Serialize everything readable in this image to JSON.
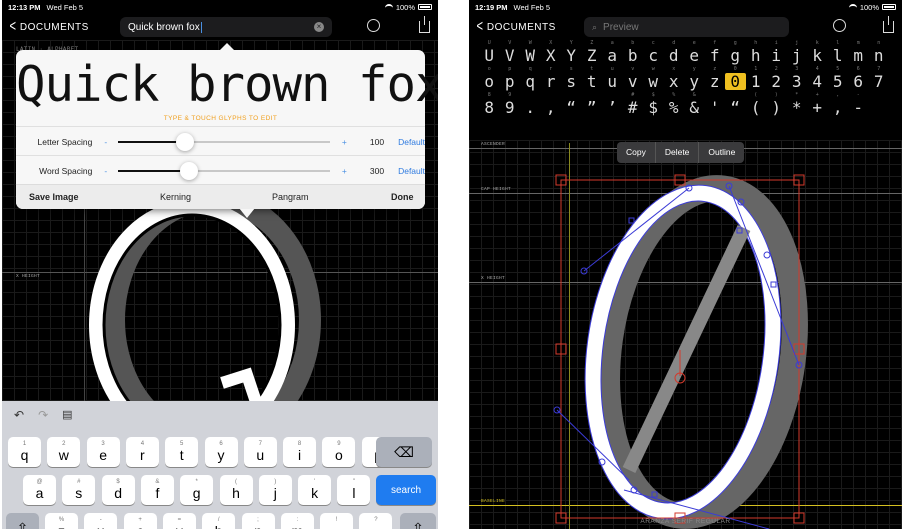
{
  "left": {
    "status": {
      "time": "12:13 PM",
      "date": "Wed Feb 5",
      "battery": "100%"
    },
    "nav": {
      "back_label": "DOCUMENTS",
      "search_value": "Quick brown fox"
    },
    "header_label": "LATIN · ALPHABET",
    "guide_xheight": "X HEIGHT",
    "popup": {
      "preview_text": "Quick brown fox",
      "hint": "TYPE & TOUCH GLYPHS TO EDIT",
      "letter_spacing": {
        "label": "Letter Spacing",
        "minus": "-",
        "plus": "+",
        "value": "100",
        "default": "Default",
        "level": 0.3
      },
      "word_spacing": {
        "label": "Word Spacing",
        "minus": "-",
        "plus": "+",
        "value": "300",
        "default": "Default",
        "level": 0.32
      },
      "actions": {
        "save": "Save Image",
        "kerning": "Kerning",
        "pangram": "Pangram",
        "done": "Done"
      }
    },
    "big_glyph": "Q",
    "keyboard": {
      "row1": [
        {
          "sub": "1",
          "k": "q"
        },
        {
          "sub": "2",
          "k": "w"
        },
        {
          "sub": "3",
          "k": "e"
        },
        {
          "sub": "4",
          "k": "r"
        },
        {
          "sub": "5",
          "k": "t"
        },
        {
          "sub": "6",
          "k": "y"
        },
        {
          "sub": "7",
          "k": "u"
        },
        {
          "sub": "8",
          "k": "i"
        },
        {
          "sub": "9",
          "k": "o"
        },
        {
          "sub": "0",
          "k": "p"
        }
      ],
      "row2": [
        {
          "sub": "@",
          "k": "a"
        },
        {
          "sub": "#",
          "k": "s"
        },
        {
          "sub": "$",
          "k": "d"
        },
        {
          "sub": "&",
          "k": "f"
        },
        {
          "sub": "*",
          "k": "g"
        },
        {
          "sub": "(",
          "k": "h"
        },
        {
          "sub": ")",
          "k": "j"
        },
        {
          "sub": "'",
          "k": "k"
        },
        {
          "sub": "\"",
          "k": "l"
        }
      ],
      "row3": [
        {
          "sub": "%",
          "k": "z"
        },
        {
          "sub": "-",
          "k": "x"
        },
        {
          "sub": "+",
          "k": "c"
        },
        {
          "sub": "=",
          "k": "v"
        },
        {
          "sub": "/",
          "k": "b"
        },
        {
          "sub": ";",
          "k": "n"
        },
        {
          "sub": ":",
          "k": "m"
        },
        {
          "sub": "!",
          "k": ","
        },
        {
          "sub": "?",
          "k": "."
        }
      ],
      "search_key": "search"
    }
  },
  "right": {
    "status": {
      "time": "12:19 PM",
      "date": "Wed Feb 5",
      "battery": "100%"
    },
    "nav": {
      "back_label": "DOCUMENTS",
      "search_placeholder": "Preview"
    },
    "glyph_row1": [
      {
        "t": "U",
        "c": "U"
      },
      {
        "t": "V",
        "c": "V"
      },
      {
        "t": "W",
        "c": "W"
      },
      {
        "t": "X",
        "c": "X"
      },
      {
        "t": "Y",
        "c": "Y"
      },
      {
        "t": "Z",
        "c": "Z"
      },
      {
        "t": "a",
        "c": "a"
      },
      {
        "t": "b",
        "c": "b"
      },
      {
        "t": "c",
        "c": "c"
      },
      {
        "t": "d",
        "c": "d"
      },
      {
        "t": "e",
        "c": "e"
      },
      {
        "t": "f",
        "c": "f"
      },
      {
        "t": "g",
        "c": "g"
      },
      {
        "t": "h",
        "c": "h"
      },
      {
        "t": "i",
        "c": "i"
      },
      {
        "t": "j",
        "c": "j"
      },
      {
        "t": "k",
        "c": "k"
      },
      {
        "t": "l",
        "c": "l"
      },
      {
        "t": "m",
        "c": "m"
      },
      {
        "t": "n",
        "c": "n"
      }
    ],
    "glyph_row2": [
      {
        "t": "o",
        "c": "o"
      },
      {
        "t": "p",
        "c": "p"
      },
      {
        "t": "q",
        "c": "q"
      },
      {
        "t": "r",
        "c": "r"
      },
      {
        "t": "s",
        "c": "s"
      },
      {
        "t": "t",
        "c": "t"
      },
      {
        "t": "u",
        "c": "u"
      },
      {
        "t": "v",
        "c": "v"
      },
      {
        "t": "w",
        "c": "w"
      },
      {
        "t": "x",
        "c": "x"
      },
      {
        "t": "y",
        "c": "y"
      },
      {
        "t": "z",
        "c": "z"
      },
      {
        "t": "0",
        "c": "0",
        "sel": true
      },
      {
        "t": "1",
        "c": "1"
      },
      {
        "t": "2",
        "c": "2"
      },
      {
        "t": "3",
        "c": "3"
      },
      {
        "t": "4",
        "c": "4"
      },
      {
        "t": "5",
        "c": "5"
      },
      {
        "t": "6",
        "c": "6"
      },
      {
        "t": "7",
        "c": "7"
      }
    ],
    "glyph_row3": [
      {
        "t": "8",
        "c": "8"
      },
      {
        "t": "9",
        "c": "9"
      },
      {
        "t": "",
        "c": "."
      },
      {
        "t": "",
        "c": ","
      },
      {
        "t": "",
        "c": "“"
      },
      {
        "t": "",
        "c": "”"
      },
      {
        "t": "",
        "c": "’"
      },
      {
        "t": "#",
        "c": "#"
      },
      {
        "t": "$",
        "c": "$"
      },
      {
        "t": "%",
        "c": "%"
      },
      {
        "t": "&",
        "c": "&"
      },
      {
        "t": "",
        "c": "'"
      },
      {
        "t": "",
        "c": "“"
      },
      {
        "t": "(",
        "c": "("
      },
      {
        "t": ")",
        "c": ")"
      },
      {
        "t": "*",
        "c": "*"
      },
      {
        "t": "+",
        "c": "+"
      },
      {
        "t": ",",
        "c": ","
      },
      {
        "t": "-",
        "c": "-"
      }
    ],
    "ctx_menu": [
      "Copy",
      "Delete",
      "Outline"
    ],
    "guide_ascender": "ASCENDER",
    "guide_capheight": "CAP HEIGHT",
    "guide_xheight": "X HEIGHT",
    "guide_baseline": "BASELINE",
    "font_name": "ARANZA SERIF REGULAR",
    "big_glyph": "0",
    "colors": {
      "selected": "#f0c020",
      "outline": "#3b3bd6",
      "bounds": "#d33a2c",
      "guide_baseline": "#d4c020"
    }
  }
}
